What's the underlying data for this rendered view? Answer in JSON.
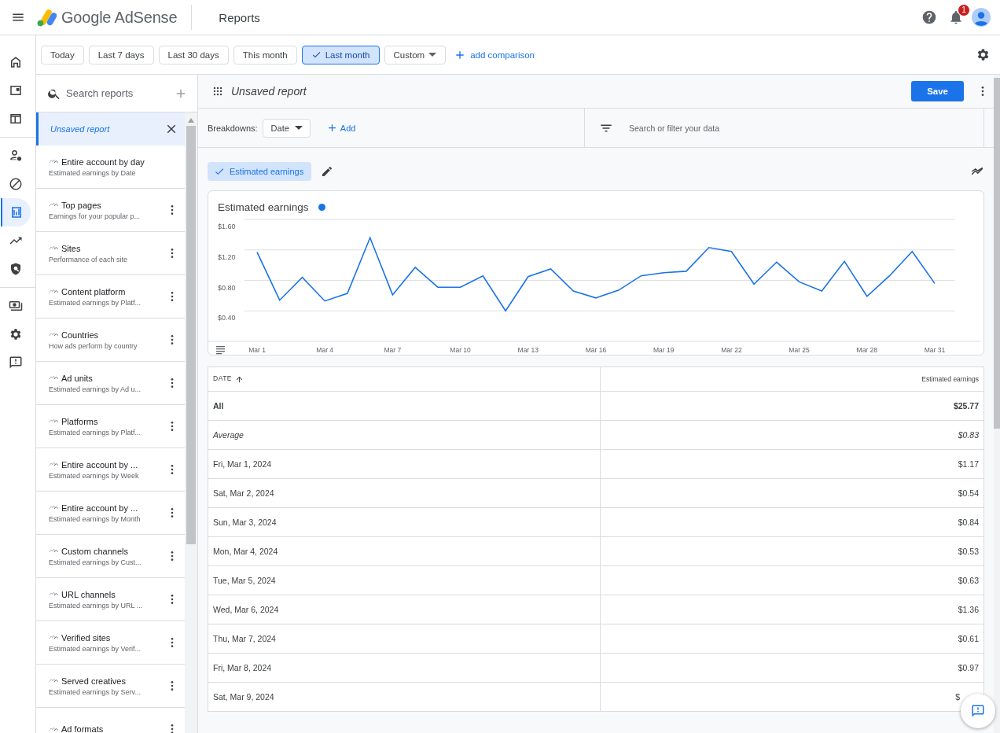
{
  "app": {
    "title": "Google AdSense",
    "page": "Reports",
    "notifications": "1"
  },
  "rail": [
    {
      "kind": "home",
      "selected": false
    },
    {
      "kind": "ads",
      "selected": false
    },
    {
      "kind": "layout",
      "selected": false
    },
    {
      "kind": "people",
      "selected": false
    },
    {
      "kind": "block",
      "selected": false
    },
    {
      "kind": "reports",
      "selected": true
    },
    {
      "kind": "trend",
      "selected": false
    },
    {
      "kind": "shield",
      "selected": false
    },
    {
      "kind": "payments",
      "selected": false
    },
    {
      "kind": "settings",
      "selected": false
    },
    {
      "kind": "feedback",
      "selected": false
    }
  ],
  "date_ranges": [
    {
      "label": "Today",
      "selected": false
    },
    {
      "label": "Last 7 days",
      "selected": false
    },
    {
      "label": "Last 30 days",
      "selected": false
    },
    {
      "label": "This month",
      "selected": false
    },
    {
      "label": "Last month",
      "selected": true
    }
  ],
  "custom_range": {
    "label": "Custom"
  },
  "add_comparison": "add comparison",
  "reports": {
    "search_placeholder": "Search reports",
    "items": [
      {
        "kind": "unsaved",
        "name": "Unsaved report",
        "selected": true
      },
      {
        "kind": "default",
        "name": "Entire account by day",
        "description": "Estimated earnings by Date",
        "selected": false
      },
      {
        "kind": "saved",
        "name": "Top pages",
        "description": "Earnings for your popular p...",
        "selected": false
      },
      {
        "kind": "saved",
        "name": "Sites",
        "description": "Performance of each site",
        "selected": false
      },
      {
        "kind": "saved",
        "name": "Content platform",
        "description": "Estimated earnings by Platf...",
        "selected": false
      },
      {
        "kind": "saved",
        "name": "Countries",
        "description": "How ads perform by country",
        "selected": false
      },
      {
        "kind": "saved",
        "name": "Ad units",
        "description": "Estimated earnings by Ad u...",
        "selected": false
      },
      {
        "kind": "saved",
        "name": "Platforms",
        "description": "Estimated earnings by Platf...",
        "selected": false
      },
      {
        "kind": "saved",
        "name": "Entire account by ...",
        "description": "Estimated earnings by Week",
        "selected": false
      },
      {
        "kind": "saved",
        "name": "Entire account by ...",
        "description": "Estimated earnings by Month",
        "selected": false
      },
      {
        "kind": "saved",
        "name": "Custom channels",
        "description": "Estimated earnings by Cust...",
        "selected": false
      },
      {
        "kind": "saved",
        "name": "URL channels",
        "description": "Estimated earnings by URL ...",
        "selected": false
      },
      {
        "kind": "saved",
        "name": "Verified sites",
        "description": "Estimated earnings by Verif...",
        "selected": false
      },
      {
        "kind": "saved",
        "name": "Served creatives",
        "description": "Estimated earnings by Serv...",
        "selected": false
      },
      {
        "kind": "saved",
        "name": "Ad formats",
        "selected": false
      }
    ]
  },
  "report": {
    "title": "Unsaved report",
    "save": "Save",
    "breakdowns_label": "Breakdowns:",
    "breakdown": "Date",
    "add": "Add",
    "filter_placeholder": "Search or filter your data",
    "metrics": [
      {
        "label": "Estimated earnings",
        "selected": true
      }
    ]
  },
  "chart": {
    "chart_data": {
      "type": "line",
      "grid": true,
      "categories": [
        "Mar 1",
        null,
        null,
        "Mar 4",
        null,
        null,
        "Mar 7",
        null,
        null,
        "Mar 10",
        null,
        null,
        "Mar 13",
        null,
        null,
        "Mar 16",
        null,
        null,
        "Mar 19",
        null,
        null,
        "Mar 22",
        null,
        null,
        "Mar 25",
        null,
        null,
        "Mar 28",
        null,
        null,
        "Mar 31"
      ],
      "series": [
        {
          "name": "Estimated earnings",
          "color": "#1a73e8",
          "values": [
            1.17,
            0.54,
            0.84,
            0.53,
            0.63,
            1.36,
            0.61,
            0.97,
            0.71,
            0.71,
            0.86,
            0.4,
            0.85,
            0.95,
            0.66,
            0.57,
            0.67,
            0.86,
            0.9,
            0.92,
            1.23,
            1.18,
            0.75,
            1.04,
            0.78,
            0.66,
            1.05,
            0.59,
            0.86,
            1.18,
            0.76
          ]
        }
      ],
      "ylim": [
        0,
        1.6
      ],
      "yticks": [
        {
          "value": 0.4,
          "label": "$0.40"
        },
        {
          "value": 0.8,
          "label": "$0.80"
        },
        {
          "value": 1.2,
          "label": "$1.20"
        },
        {
          "value": 1.6,
          "label": "$1.60"
        }
      ]
    }
  },
  "table": {
    "columns": [
      {
        "label": "DATE",
        "sorted": true
      },
      {
        "label": "Estimated earnings",
        "sorted": false
      }
    ],
    "rows": [
      {
        "kind": "total",
        "date": "All",
        "value": "$25.77"
      },
      {
        "kind": "average",
        "date": "Average",
        "value": "$0.83"
      },
      {
        "kind": "day",
        "date": "Fri, Mar 1, 2024",
        "value": "$1.17"
      },
      {
        "kind": "day",
        "date": "Sat, Mar 2, 2024",
        "value": "$0.54"
      },
      {
        "kind": "day",
        "date": "Sun, Mar 3, 2024",
        "value": "$0.84"
      },
      {
        "kind": "day",
        "date": "Mon, Mar 4, 2024",
        "value": "$0.53"
      },
      {
        "kind": "day",
        "date": "Tue, Mar 5, 2024",
        "value": "$0.63"
      },
      {
        "kind": "day",
        "date": "Wed, Mar 6, 2024",
        "value": "$1.36"
      },
      {
        "kind": "day",
        "date": "Thu, Mar 7, 2024",
        "value": "$0.61"
      },
      {
        "kind": "day",
        "date": "Fri, Mar 8, 2024",
        "value": "$0.97"
      },
      {
        "kind": "day",
        "date": "Sat, Mar 9, 2024",
        "value": "$"
      }
    ]
  }
}
